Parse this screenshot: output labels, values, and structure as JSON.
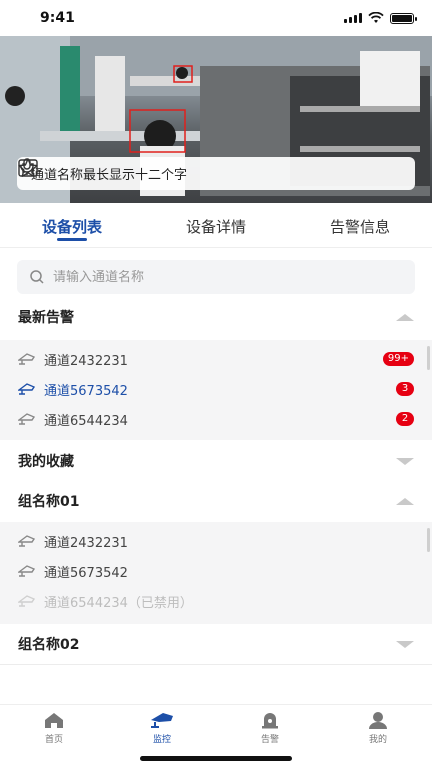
{
  "status_bar": {
    "time": "9:41"
  },
  "video": {
    "channel_title": "通道名称最长显示十二个字",
    "controls": [
      "microphone-icon",
      "star-icon",
      "fullscreen-icon"
    ]
  },
  "tabs": [
    {
      "label": "设备列表",
      "active": true
    },
    {
      "label": "设备详情",
      "active": false
    },
    {
      "label": "告警信息",
      "active": false
    }
  ],
  "search": {
    "placeholder": "请输入通道名称"
  },
  "sections": {
    "latest_alarms": {
      "title": "最新告警",
      "expanded": true,
      "items": [
        {
          "name": "通道2432231",
          "badge": "99+"
        },
        {
          "name": "通道5673542",
          "badge": "3"
        },
        {
          "name": "通道6544234",
          "badge": "2"
        }
      ]
    },
    "favorites": {
      "title": "我的收藏",
      "expanded": false
    },
    "group1": {
      "title": "组名称01",
      "expanded": true,
      "items": [
        {
          "name": "通道2432231"
        },
        {
          "name": "通道5673542"
        },
        {
          "name": "通道6544234（已禁用）"
        }
      ]
    },
    "group2": {
      "title": "组名称02",
      "expanded": false
    }
  },
  "bottom_nav": [
    {
      "label": "首页",
      "icon": "home-icon"
    },
    {
      "label": "监控",
      "icon": "camera-icon",
      "active": true
    },
    {
      "label": "告警",
      "icon": "alarm-icon"
    },
    {
      "label": "我的",
      "icon": "user-icon"
    }
  ],
  "colors": {
    "accent": "#1d4fa8",
    "badge": "#e60012"
  }
}
